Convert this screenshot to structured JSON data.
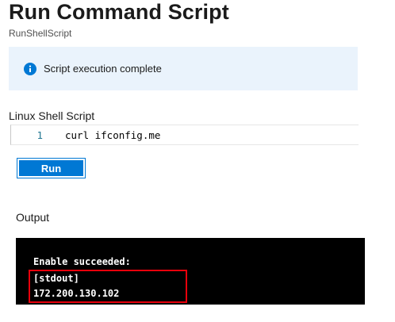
{
  "header": {
    "title": "Run Command Script",
    "subtitle": "RunShellScript"
  },
  "banner": {
    "icon": "info-icon",
    "message": "Script execution complete",
    "accent_color": "#0078d4"
  },
  "editor": {
    "label": "Linux Shell Script",
    "lines": [
      {
        "number": "1",
        "code": "curl ifconfig.me"
      }
    ]
  },
  "actions": {
    "run_label": "Run"
  },
  "output": {
    "label": "Output",
    "lines": [
      "Enable succeeded:",
      "[stdout]",
      "172.200.130.102"
    ],
    "highlight_color": "#e8000b"
  }
}
